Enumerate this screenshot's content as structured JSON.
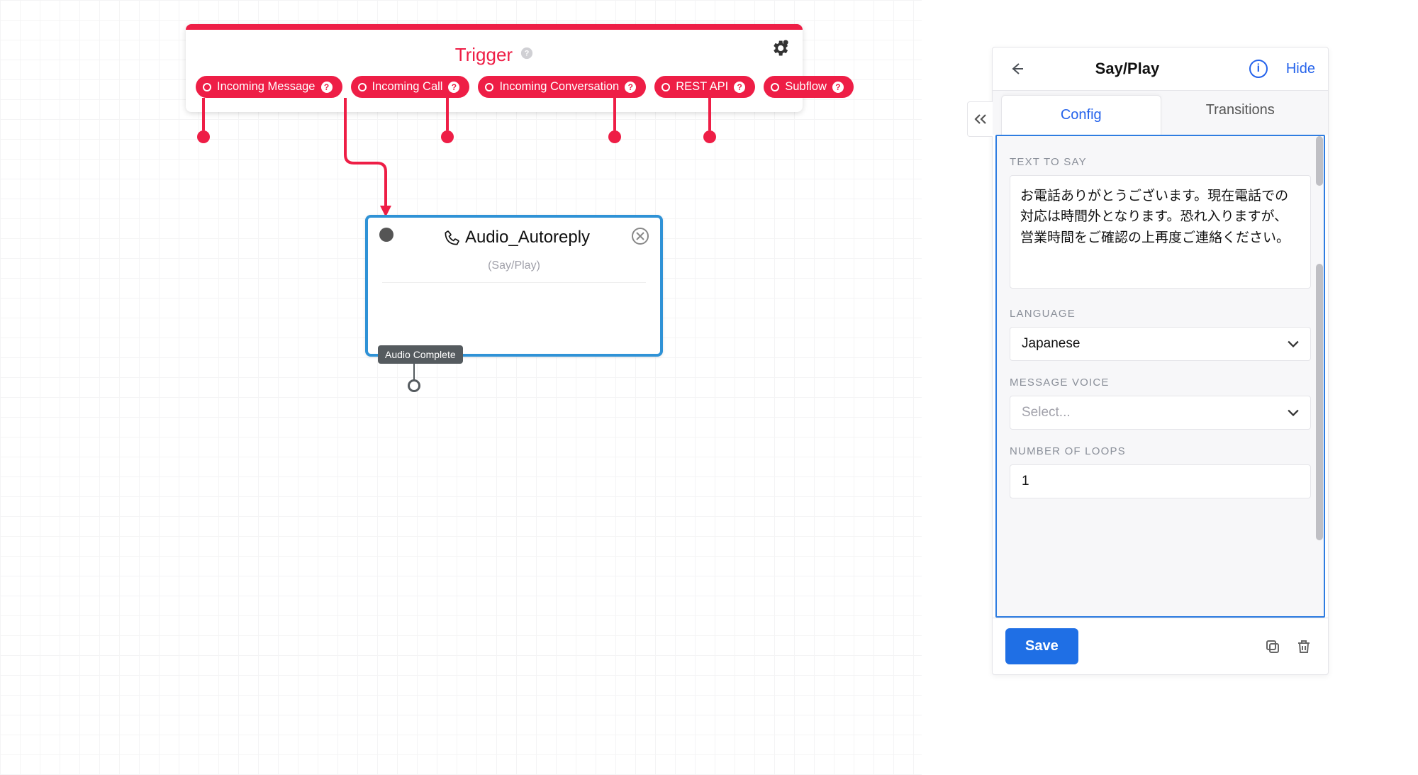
{
  "trigger": {
    "title": "Trigger",
    "events": [
      {
        "label": "Incoming Message"
      },
      {
        "label": "Incoming Call"
      },
      {
        "label": "Incoming Conversation"
      },
      {
        "label": "REST API"
      },
      {
        "label": "Subflow"
      }
    ]
  },
  "node": {
    "title": "Audio_Autoreply",
    "subtype": "(Say/Play)",
    "outlet_label": "Audio Complete"
  },
  "panel": {
    "title": "Say/Play",
    "hide_label": "Hide",
    "tabs": {
      "config": "Config",
      "transitions": "Transitions"
    },
    "labels": {
      "text_to_say": "TEXT TO SAY",
      "language": "LANGUAGE",
      "voice": "MESSAGE VOICE",
      "loops": "NUMBER OF LOOPS"
    },
    "values": {
      "text_to_say": "お電話ありがとうございます。現在電話での対応は時間外となります。恐れ入りますが、営業時間をご確認の上再度ご連絡ください。",
      "language": "Japanese",
      "voice_placeholder": "Select...",
      "loops": "1"
    },
    "save_label": "Save"
  }
}
